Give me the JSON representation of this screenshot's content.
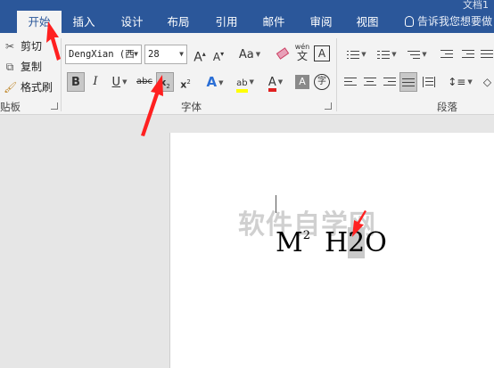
{
  "title_fragment": "文档1",
  "tabs": [
    {
      "label": "开始",
      "active": true
    },
    {
      "label": "插入"
    },
    {
      "label": "设计"
    },
    {
      "label": "布局"
    },
    {
      "label": "引用"
    },
    {
      "label": "邮件"
    },
    {
      "label": "审阅"
    },
    {
      "label": "视图"
    }
  ],
  "tell_me": "告诉我您想要做",
  "clipboard": {
    "cut": "剪切",
    "copy": "复制",
    "format_painter": "格式刷",
    "label": "贴板"
  },
  "font": {
    "name": "DengXian (西",
    "size": "28",
    "label": "字体",
    "bold": "B",
    "italic": "I",
    "underline": "U",
    "strike": "abc",
    "subscript": "x",
    "subscript_sub": "2",
    "superscript": "x",
    "superscript_sup": "2",
    "grow": "A",
    "shrink": "A",
    "case": "Aa",
    "phonetic_top": "wén",
    "phonetic_main": "文",
    "border_char": "A",
    "effects": "A",
    "highlight": "ab",
    "font_color": "A",
    "shade": "A",
    "enclose": "字"
  },
  "paragraph": {
    "label": "段落"
  },
  "colors": {
    "accent": "#2b579a",
    "highlight": "#ffff00",
    "font_color": "#e02020",
    "arrow": "#ff2020"
  },
  "document": {
    "text_main": "M",
    "text_sup": "2",
    "text_h": "H",
    "text_selected": "2",
    "text_tail": "O",
    "watermark": "软件自学网"
  }
}
